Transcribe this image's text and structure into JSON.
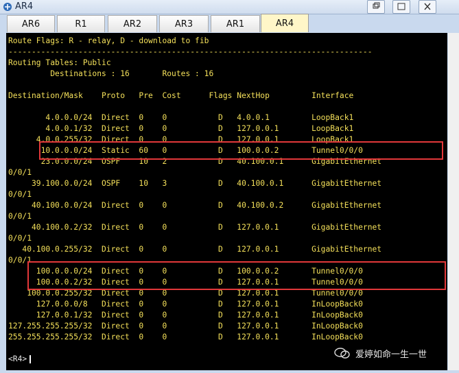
{
  "window": {
    "title": "AR4"
  },
  "tabs": [
    {
      "label": "AR6"
    },
    {
      "label": "R1"
    },
    {
      "label": "AR2"
    },
    {
      "label": "AR3"
    },
    {
      "label": "AR1"
    },
    {
      "label": "AR4",
      "active": true
    }
  ],
  "terminal": {
    "lines": [
      "Route Flags: R - relay, D - download to fib",
      "------------------------------------------------------------------------------",
      "Routing Tables: Public",
      "         Destinations : 16       Routes : 16",
      "",
      "Destination/Mask    Proto   Pre  Cost      Flags NextHop         Interface",
      "",
      "        4.0.0.0/24  Direct  0    0           D   4.0.0.1         LoopBack1",
      "        4.0.0.1/32  Direct  0    0           D   127.0.0.1       LoopBack1",
      "      4.0.0.255/32  Direct  0    0           D   127.0.0.1       LoopBack1",
      "       10.0.0.0/24  Static  60   0           D   100.0.0.2       Tunnel0/0/0",
      "       23.0.0.0/24  OSPF    10   2           D   40.100.0.1      GigabitEthernet",
      "0/0/1",
      "     39.100.0.0/24  OSPF    10   3           D   40.100.0.1      GigabitEthernet",
      "0/0/1",
      "     40.100.0.0/24  Direct  0    0           D   40.100.0.2      GigabitEthernet",
      "0/0/1",
      "     40.100.0.2/32  Direct  0    0           D   127.0.0.1       GigabitEthernet",
      "0/0/1",
      "   40.100.0.255/32  Direct  0    0           D   127.0.0.1       GigabitEthernet",
      "0/0/1",
      "      100.0.0.0/24  Direct  0    0           D   100.0.0.2       Tunnel0/0/0",
      "      100.0.0.2/32  Direct  0    0           D   127.0.0.1       Tunnel0/0/0",
      "    100.0.0.255/32  Direct  0    0           D   127.0.0.1       Tunnel0/0/0",
      "      127.0.0.0/8   Direct  0    0           D   127.0.0.1       InLoopBack0",
      "      127.0.0.1/32  Direct  0    0           D   127.0.0.1       InLoopBack0",
      "127.255.255.255/32  Direct  0    0           D   127.0.0.1       InLoopBack0",
      "255.255.255.255/32  Direct  0    0           D   127.0.0.1       InLoopBack0",
      "",
      "<R4>"
    ]
  },
  "watermark": {
    "text": "爱婷如命一生一世"
  },
  "colors": {
    "terminal_text": "#f4e05a",
    "highlight": "#e3383a",
    "active_tab": "#fff6c8"
  }
}
